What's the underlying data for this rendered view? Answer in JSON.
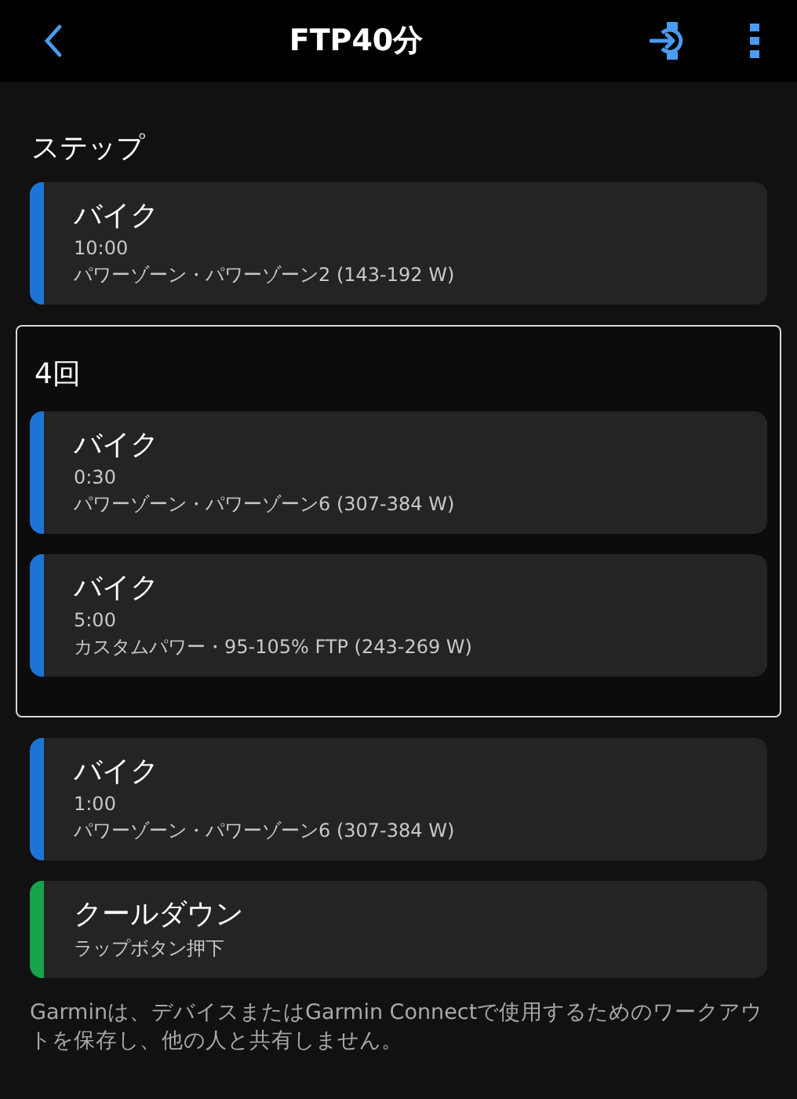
{
  "header": {
    "title": "FTP40分"
  },
  "section_title": "ステップ",
  "steps": [
    {
      "kind": "step",
      "title": "バイク",
      "duration": "10:00",
      "target": "パワーゾーン・パワーゾーン2 (143-192 W)",
      "color": "#1e74d6"
    },
    {
      "kind": "repeat",
      "label": "4回",
      "children": [
        {
          "kind": "step",
          "title": "バイク",
          "duration": "0:30",
          "target": "パワーゾーン・パワーゾーン6 (307-384 W)",
          "color": "#1e74d6"
        },
        {
          "kind": "step",
          "title": "バイク",
          "duration": "5:00",
          "target": "カスタムパワー・95-105% FTP (243-269 W)",
          "color": "#1e74d6"
        }
      ]
    },
    {
      "kind": "step",
      "title": "バイク",
      "duration": "1:00",
      "target": "パワーゾーン・パワーゾーン6 (307-384 W)",
      "color": "#1e74d6"
    },
    {
      "kind": "step",
      "title": "クールダウン",
      "target": "ラップボタン押下",
      "color": "#17a34a"
    }
  ],
  "footer": "Garminは、デバイスまたはGarmin Connectで使用するためのワークアウトを保存し、他の人と共有しません。"
}
